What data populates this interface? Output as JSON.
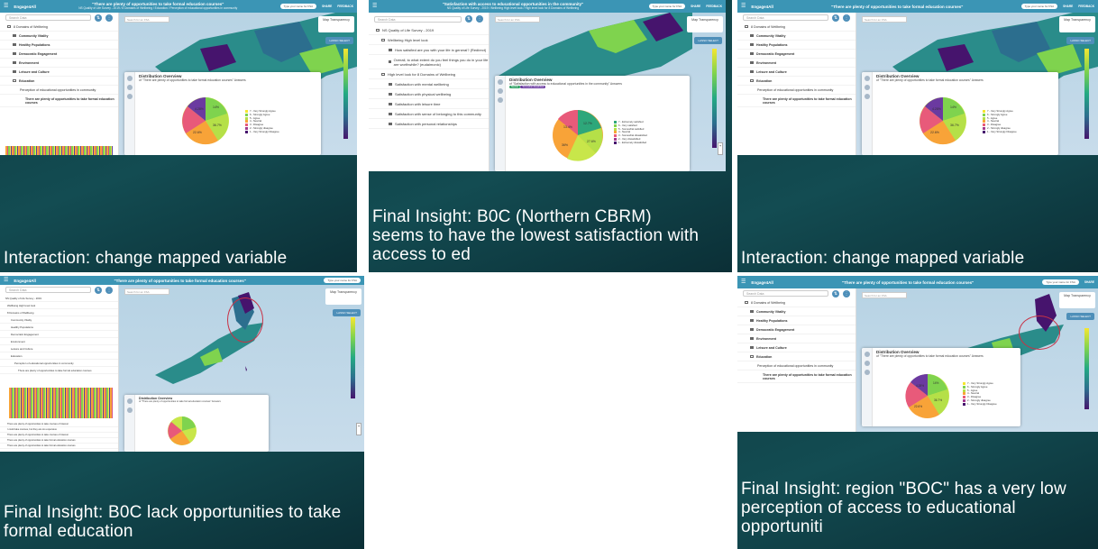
{
  "colors": {
    "appbar": "#3b95b5",
    "panel_bg": "#134c52",
    "accent": "#4e8fb9",
    "tag_green": "#2e9f62",
    "tag_purple": "#6b3aa0",
    "highlight": "#c83246"
  },
  "app": {
    "brand": "Engage4All",
    "menu_icon": "menu-icon",
    "search_placeholder": "Search Data",
    "map_search_placeholder": "Search for an FSA",
    "map_transparency": "Map Transparency",
    "lasso_select": "LASSO SELECT",
    "pill_text": "Type your name for FSA",
    "nav": [
      "SHARE",
      "FEEDBACK",
      "TU"
    ]
  },
  "panels": [
    {
      "id": "p1",
      "title": "\"There are plenty of opportunities to take formal education courses\"",
      "subtitle": "NS Quality of Life Survey - 2019 / 8 Domains of Wellbeing / Education / Perception of educational opportunities in community",
      "tree": [
        "8 Domains of Wellbeing",
        "Community Vitality",
        "Healthy Populations",
        "Democratic Engagement",
        "Environment",
        "Leisure and Culture",
        "Education",
        "Perception of educational opportunities in community",
        "There are plenty of opportunities to take formal education courses"
      ],
      "dist_title": "Distribution Overview",
      "dist_sub": "of \"There are plenty of opportunities to take formal education courses\" Answers",
      "legend": [
        "7 - Very Strongly Agree",
        "6 - Strongly Agree",
        "5 - Agree",
        "4 - Neutral",
        "3 - Disagree",
        "2 - Strongly disagree",
        "1 - Very Strongly Disagree"
      ],
      "pie_labels": [
        "4.28%",
        "14%",
        "36.7%",
        "22.6%"
      ],
      "caption": "Interaction: change mapped variable"
    },
    {
      "id": "p2",
      "title": "\"Satisfaction with access to educational opportunities in the community\"",
      "subtitle": "NS Quality of Life Survey - 2019 / Wellbeing High level look / High level look for 8 Domains of Wellbeing",
      "tree": [
        "NS Quality of Life Survey - 2019",
        "Wellbeing High level look",
        "How satisfied are you with your life in general? (Redirect)",
        "Overall, to what extent do you feel things you do in your life are worthwhile? (eudaimonic)",
        "High level look for 8 Domains of Wellbeing",
        "Satisfaction with mental wellbeing",
        "Satisfaction with physical wellbeing",
        "Satisfaction with leisure time",
        "Satisfaction with sense of belonging to this community",
        "Satisfaction with personal relationships"
      ],
      "dist_title": "Distribution Overview",
      "dist_sub": "of \"Satisfaction with access to educational opportunities in the community\" Answers",
      "legend": [
        "7 - Extremely satisfied",
        "6 - Very satisfied",
        "5 - Somewhat satisfied",
        "4 - Neutral",
        "3 - Somewhat dissatisfied",
        "2 - Very dissatisfied",
        "1 - Extremely dissatisfied"
      ],
      "pie_labels": [
        "12.7%",
        "27.6%",
        "36%",
        "13.4%"
      ],
      "tags": [
        "Neutral",
        "Somewhat dissatisfied"
      ],
      "caption": "Final Insight: B0C (Northern CBRM) seems to have the lowest satisfaction with access to ed"
    },
    {
      "id": "p3",
      "title": "\"There are plenty of opportunities to take formal education courses\"",
      "tree": [
        "8 Domains of Wellbeing",
        "Community Vitality",
        "Healthy Populations",
        "Democratic Engagement",
        "Environment",
        "Leisure and Culture",
        "Education",
        "Perception of educational opportunities in community",
        "There are plenty of opportunities to take formal education courses"
      ],
      "dist_title": "Distribution Overview",
      "dist_sub": "of \"There are plenty of opportunities to take formal education courses\" Answers",
      "legend": [
        "7 - Very Strongly Agree",
        "6 - Strongly Agree",
        "5 - Agree",
        "4 - Neutral",
        "3 - Disagree",
        "2 - Strongly disagree",
        "1 - Very Strongly Disagree"
      ],
      "pie_labels": [
        "4.28%",
        "14%",
        "36.7%",
        "22.6%"
      ],
      "caption": "Interaction: change mapped variable"
    },
    {
      "id": "p4",
      "title": "\"There are plenty of opportunities to take formal education courses\"",
      "tree": [
        "NS Quality of Life Survey - 2019",
        "Wellbeing High level look",
        "8 Domains of Wellbeing",
        "Community Vitality",
        "Healthy Populations",
        "Democratic Engagement",
        "Environment",
        "Leisure and Culture",
        "Education",
        "Perception of educational opportunities in community",
        "There are plenty of opportunities to take formal education courses"
      ],
      "tree_after": [
        "There are plenty of opportunities to take courses of interest",
        "I could take courses, but they are too expensive",
        "There are plenty of opportunities to take courses of interest",
        "There are plenty of opportunities to take formal education courses",
        "There are plenty of opportunities to take formal education courses"
      ],
      "dist_title": "Distribution Overview",
      "dist_sub": "of \"There are plenty of opportunities to take formal education courses\" Answers",
      "caption": "Final Insight: B0C lack opportunities to take formal education"
    },
    {
      "id": "p5",
      "title": "\"There are plenty of opportunities to take formal education courses\"",
      "tree": [
        "8 Domains of Wellbeing",
        "Community Vitality",
        "Healthy Populations",
        "Democratic Engagement",
        "Environment",
        "Leisure and Culture",
        "Education",
        "Perception of educational opportunities in community",
        "There are plenty of opportunities to take formal education courses"
      ],
      "dist_title": "Distribution Overview",
      "dist_sub": "of \"There are plenty of opportunities to take formal education courses\" Answers",
      "legend": [
        "7 - Very Strongly Agree",
        "6 - Strongly Agree",
        "5 - Agree",
        "4 - Neutral",
        "3 - Disagree",
        "2 - Strongly disagree",
        "1 - Very Strongly Disagree"
      ],
      "pie_labels": [
        "4.28%",
        "14%",
        "36.7%",
        "22.6%"
      ],
      "caption": "Final Insight: region \"BOC\" has a very low perception of access to educational opportuniti"
    }
  ]
}
